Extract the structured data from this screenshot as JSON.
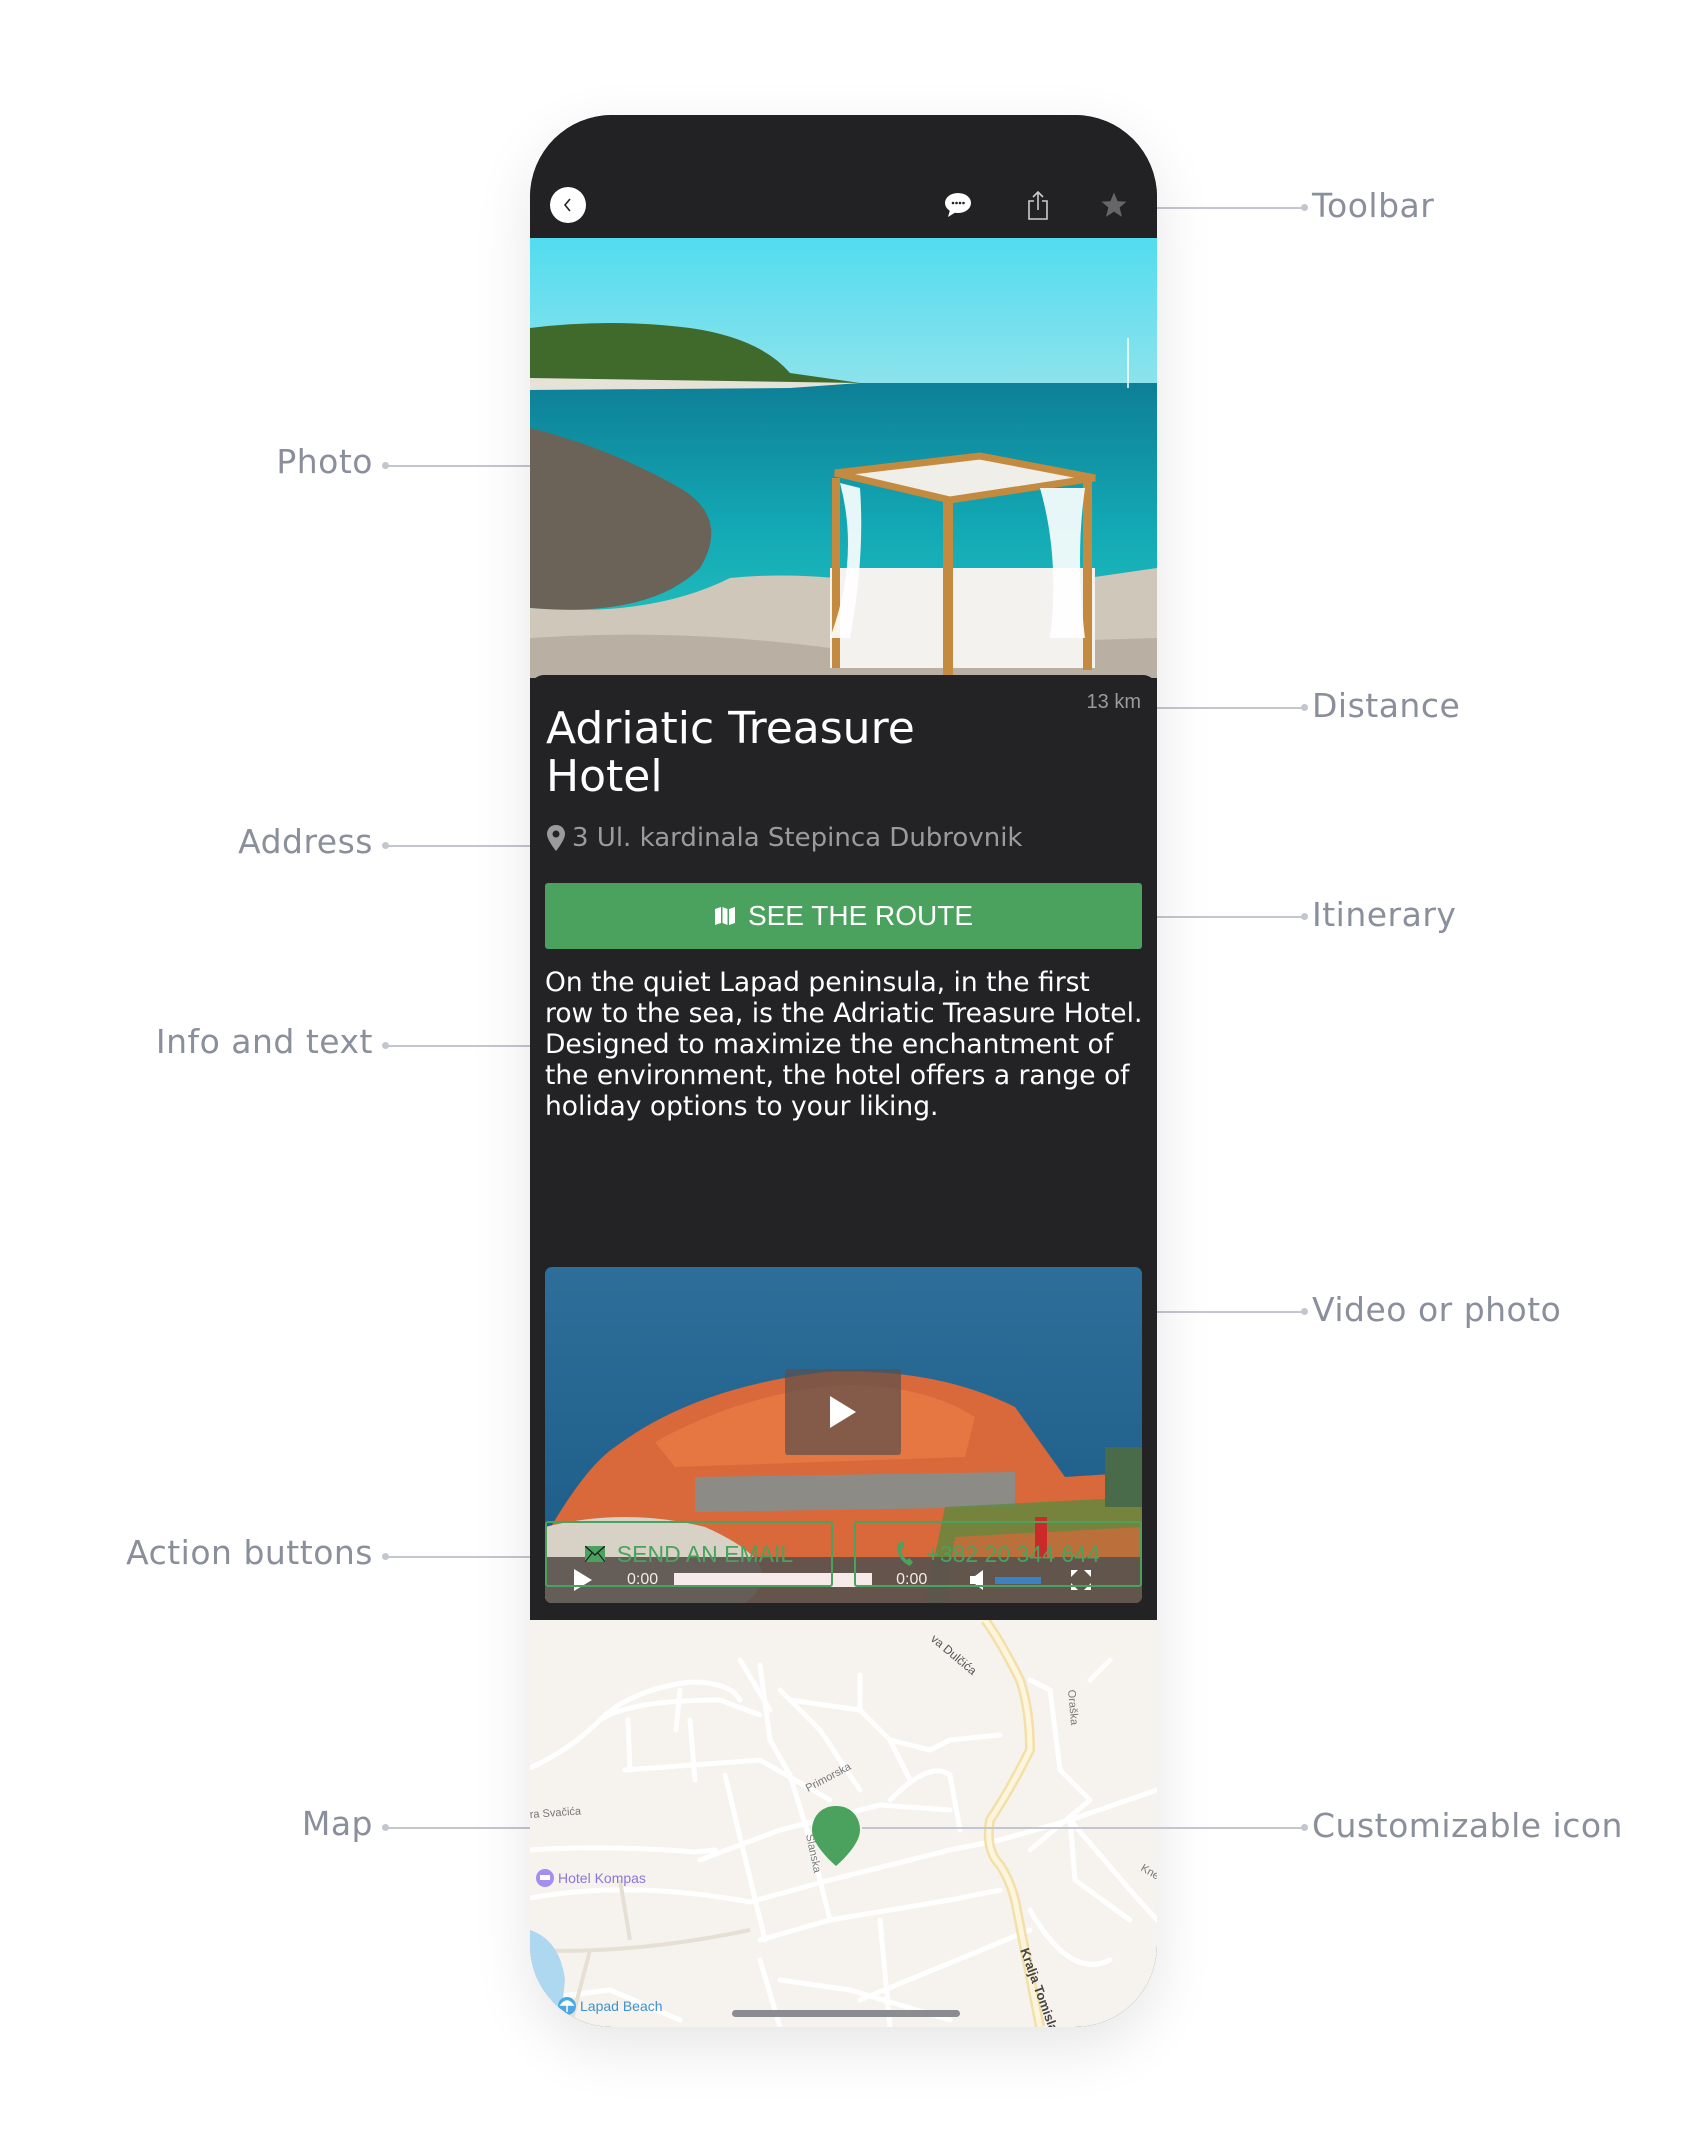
{
  "annotations": {
    "toolbar": "Toolbar",
    "photo": "Photo",
    "distance": "Distance",
    "address": "Address",
    "itinerary": "Itinerary",
    "info_text": "Info and text",
    "video_photo": "Video or photo",
    "action_buttons": "Action buttons",
    "map": "Map",
    "custom_icon": "Customizable icon"
  },
  "toolbar": {
    "icons": [
      "back-icon",
      "chat-bubble-icon",
      "share-icon",
      "star-icon"
    ]
  },
  "hotel": {
    "distance": "13 km",
    "title": "Adriatic Treasure Hotel",
    "address": "3 Ul. kardinala Stepinca Dubrovnik",
    "route_button": "SEE THE ROUTE",
    "description": "On the quiet Lapad peninsula, in the first row to the sea, is the Adriatic Treasure Hotel. Designed to maximize the enchantment of the environment, the hotel offers a range of holiday options to your liking."
  },
  "video": {
    "current_time": "0:00",
    "duration": "0:00",
    "progress": 0,
    "volume": 1.0
  },
  "actions": {
    "email_label": "SEND AN EMAIL",
    "phone_label": "+382 20 344 644"
  },
  "map": {
    "streets": [
      "Dulčića",
      "Oraška",
      "Primorska",
      "Svačića",
      "Slanska",
      "Kralja Tomisla",
      "Kne"
    ],
    "pois": [
      "Hotel Kompas",
      "Lapad Beach"
    ]
  },
  "colors": {
    "accent": "#4aa25e",
    "dark_bg": "#222224",
    "label_gray": "#8a8f9c"
  }
}
